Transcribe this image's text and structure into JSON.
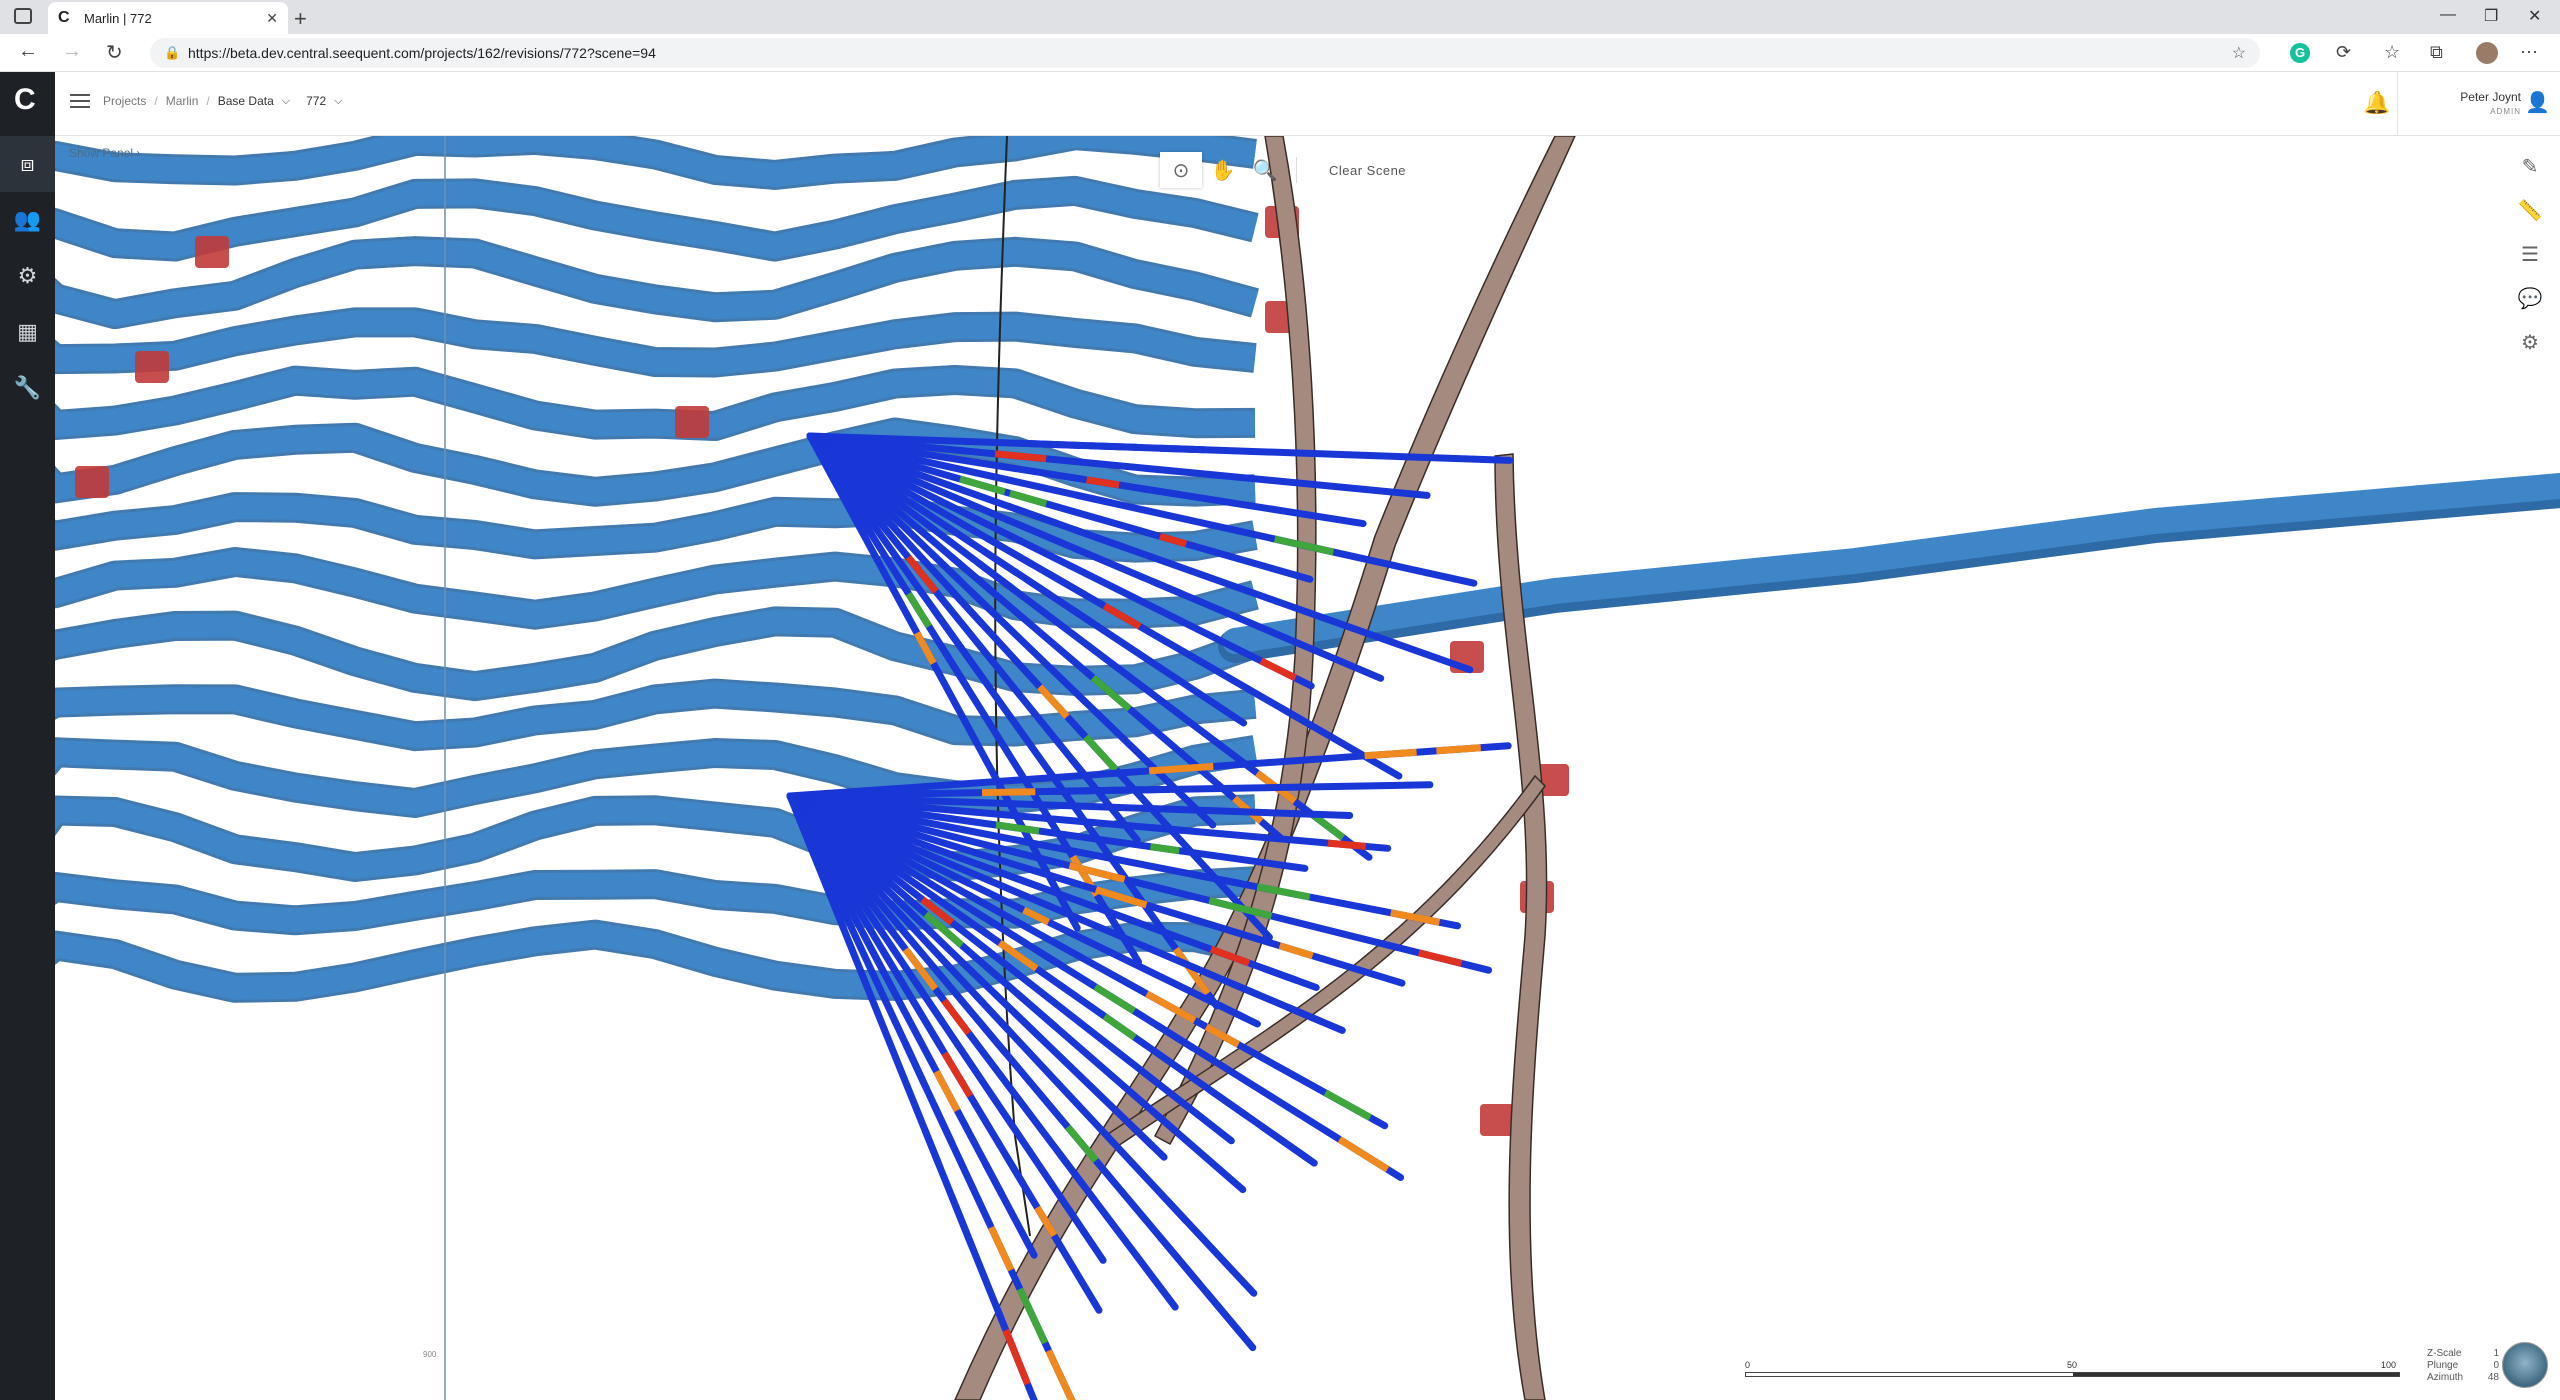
{
  "browser": {
    "tab_title": "Marlin | 772",
    "url": "https://beta.dev.central.seequent.com/projects/162/revisions/772?scene=94",
    "new_tab": "+",
    "close_tab": "✕"
  },
  "header": {
    "breadcrumbs": [
      "Projects",
      "Marlin",
      "Base Data",
      "772"
    ],
    "separator": "/",
    "user_name": "Peter Joynt",
    "user_role": "ADMIN"
  },
  "scene": {
    "show_panel_label": "Show Panel",
    "clear_scene_label": "Clear Scene",
    "scale_labels": [
      "0",
      "50",
      "100"
    ],
    "axis_tick": "900",
    "readout": [
      {
        "label": "Z-Scale",
        "value": "1"
      },
      {
        "label": "Plunge",
        "value": "0"
      },
      {
        "label": "Azimuth",
        "value": "48"
      }
    ]
  },
  "colors": {
    "tunnel": "#3f86c9",
    "tunnel_dark": "#2d6aa6",
    "fault": "#a58a80",
    "drill_blue": "#1936d6",
    "drill_red": "#e0301e",
    "drill_orange": "#f08a1e",
    "drill_green": "#3ea63a",
    "marker_red": "#c23a3a",
    "sidebar": "#1e2227"
  }
}
